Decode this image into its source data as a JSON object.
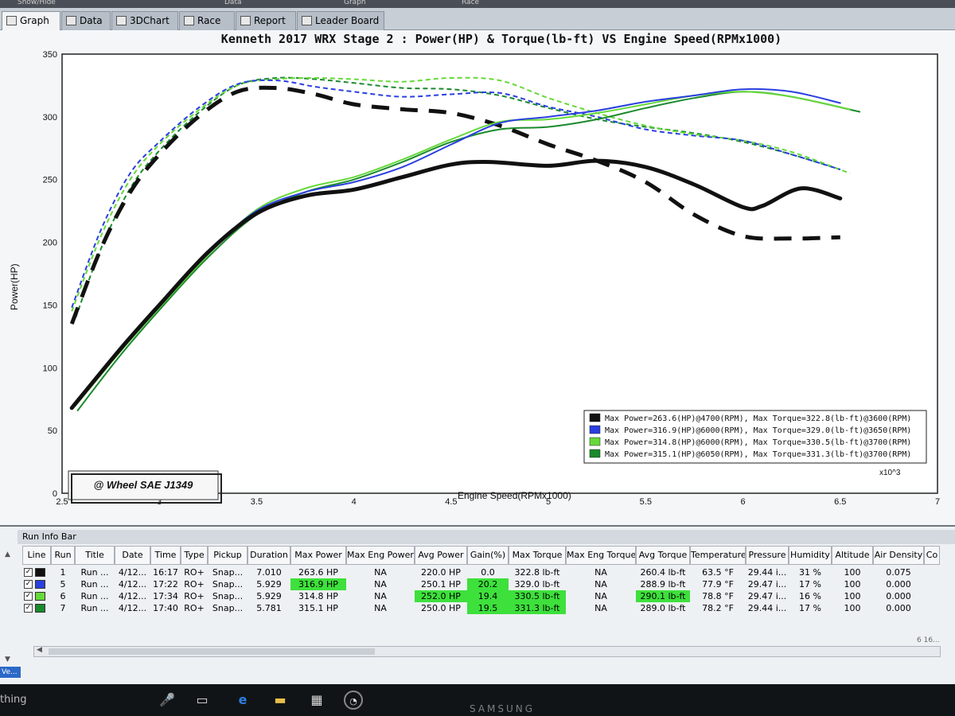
{
  "top_strip": {
    "items": [
      "Show/Hide",
      "Data",
      "Graph",
      "Race"
    ]
  },
  "tabs": [
    {
      "label": "Graph",
      "icon": "graph-icon",
      "active": true
    },
    {
      "label": "Data",
      "icon": "table-icon",
      "active": false
    },
    {
      "label": "3DChart",
      "icon": "chart3d-icon",
      "active": false
    },
    {
      "label": "Race",
      "icon": "checkered-flag-icon",
      "active": false
    },
    {
      "label": "Report",
      "icon": "report-icon",
      "active": false
    },
    {
      "label": "Leader Board",
      "icon": "checkered-flag-icon",
      "active": false
    }
  ],
  "chart_data": {
    "type": "line",
    "title": "Kenneth 2017 WRX Stage 2 : Power(HP) & Torque(lb-ft) VS Engine Speed(RPMx1000)",
    "xlabel": "Engine Speed(RPMx1000)",
    "ylabel": "Power(HP)",
    "x_multiplier": "x10^3",
    "xlim": [
      2.5,
      7
    ],
    "ylim": [
      0,
      350
    ],
    "x_ticks": [
      "2.5",
      "3",
      "3.5",
      "4",
      "4.5",
      "5",
      "5.5",
      "6",
      "6.5",
      "7"
    ],
    "y_ticks": [
      "0",
      "50",
      "100",
      "150",
      "200",
      "250",
      "300",
      "350"
    ],
    "grid": true,
    "legend_position": "bottom-right",
    "annotation": "@ Wheel SAE J1349",
    "legend": [
      "Max Power=263.6(HP)@4700(RPM), Max Torque=322.8(lb-ft)@3600(RPM)",
      "Max Power=316.9(HP)@6000(RPM), Max Torque=329.0(lb-ft)@3650(RPM)",
      "Max Power=314.8(HP)@6000(RPM), Max Torque=330.5(lb-ft)@3700(RPM)",
      "Max Power=315.1(HP)@6050(RPM), Max Torque=331.3(lb-ft)@3700(RPM)"
    ],
    "series": [
      {
        "run": "1",
        "color": "#111111",
        "width": 5,
        "power": [
          [
            2.55,
            68
          ],
          [
            2.8,
            115
          ],
          [
            3.0,
            150
          ],
          [
            3.25,
            192
          ],
          [
            3.5,
            223
          ],
          [
            3.75,
            237
          ],
          [
            4.0,
            242
          ],
          [
            4.25,
            252
          ],
          [
            4.5,
            262
          ],
          [
            4.7,
            264
          ],
          [
            5.0,
            261
          ],
          [
            5.25,
            265
          ],
          [
            5.5,
            260
          ],
          [
            5.75,
            246
          ],
          [
            6.0,
            228
          ],
          [
            6.1,
            229
          ],
          [
            6.3,
            243
          ],
          [
            6.5,
            235
          ]
        ],
        "torque": [
          [
            2.55,
            135
          ],
          [
            2.7,
            195
          ],
          [
            2.85,
            240
          ],
          [
            3.0,
            270
          ],
          [
            3.2,
            300
          ],
          [
            3.4,
            320
          ],
          [
            3.6,
            323
          ],
          [
            3.8,
            318
          ],
          [
            4.0,
            310
          ],
          [
            4.25,
            306
          ],
          [
            4.5,
            303
          ],
          [
            4.75,
            293
          ],
          [
            5.0,
            278
          ],
          [
            5.25,
            265
          ],
          [
            5.5,
            248
          ],
          [
            5.75,
            222
          ],
          [
            6.0,
            205
          ],
          [
            6.25,
            203
          ],
          [
            6.5,
            204
          ]
        ]
      },
      {
        "run": "5",
        "color": "#2a3fe0",
        "width": 2,
        "power": [
          [
            2.57,
            72
          ],
          [
            2.8,
            115
          ],
          [
            3.0,
            150
          ],
          [
            3.25,
            192
          ],
          [
            3.5,
            225
          ],
          [
            3.75,
            240
          ],
          [
            4.0,
            248
          ],
          [
            4.25,
            260
          ],
          [
            4.5,
            278
          ],
          [
            4.75,
            295
          ],
          [
            5.0,
            300
          ],
          [
            5.25,
            305
          ],
          [
            5.5,
            312
          ],
          [
            5.75,
            317
          ],
          [
            6.0,
            322
          ],
          [
            6.25,
            320
          ],
          [
            6.5,
            311
          ]
        ],
        "torque": [
          [
            2.55,
            148
          ],
          [
            2.7,
            210
          ],
          [
            2.85,
            255
          ],
          [
            3.0,
            280
          ],
          [
            3.2,
            307
          ],
          [
            3.4,
            326
          ],
          [
            3.6,
            329
          ],
          [
            3.8,
            324
          ],
          [
            4.0,
            320
          ],
          [
            4.25,
            316
          ],
          [
            4.5,
            318
          ],
          [
            4.75,
            319
          ],
          [
            5.0,
            308
          ],
          [
            5.25,
            300
          ],
          [
            5.5,
            290
          ],
          [
            5.75,
            285
          ],
          [
            6.0,
            281
          ],
          [
            6.25,
            270
          ],
          [
            6.5,
            258
          ]
        ]
      },
      {
        "run": "6",
        "color": "#66d93a",
        "width": 2,
        "power": [
          [
            2.57,
            70
          ],
          [
            2.8,
            113
          ],
          [
            3.0,
            148
          ],
          [
            3.25,
            190
          ],
          [
            3.5,
            226
          ],
          [
            3.75,
            243
          ],
          [
            4.0,
            252
          ],
          [
            4.25,
            266
          ],
          [
            4.5,
            282
          ],
          [
            4.75,
            296
          ],
          [
            5.0,
            298
          ],
          [
            5.25,
            303
          ],
          [
            5.5,
            310
          ],
          [
            5.75,
            317
          ],
          [
            6.0,
            320
          ],
          [
            6.25,
            316
          ],
          [
            6.55,
            306
          ]
        ],
        "torque": [
          [
            2.55,
            145
          ],
          [
            2.7,
            205
          ],
          [
            2.85,
            250
          ],
          [
            3.0,
            278
          ],
          [
            3.2,
            305
          ],
          [
            3.4,
            325
          ],
          [
            3.6,
            330
          ],
          [
            3.8,
            331
          ],
          [
            4.0,
            330
          ],
          [
            4.25,
            328
          ],
          [
            4.5,
            331
          ],
          [
            4.75,
            329
          ],
          [
            5.0,
            315
          ],
          [
            5.25,
            303
          ],
          [
            5.5,
            293
          ],
          [
            5.75,
            286
          ],
          [
            6.0,
            281
          ],
          [
            6.25,
            272
          ],
          [
            6.55,
            255
          ]
        ]
      },
      {
        "run": "7",
        "color": "#1b8a2c",
        "width": 2,
        "power": [
          [
            2.58,
            66
          ],
          [
            2.8,
            110
          ],
          [
            3.0,
            146
          ],
          [
            3.25,
            188
          ],
          [
            3.5,
            222
          ],
          [
            3.75,
            240
          ],
          [
            4.0,
            250
          ],
          [
            4.25,
            264
          ],
          [
            4.5,
            280
          ],
          [
            4.75,
            290
          ],
          [
            5.0,
            292
          ],
          [
            5.25,
            298
          ],
          [
            5.5,
            307
          ],
          [
            5.75,
            315
          ],
          [
            6.0,
            320
          ],
          [
            6.25,
            316
          ],
          [
            6.6,
            304
          ]
        ],
        "torque": [
          [
            2.57,
            140
          ],
          [
            2.7,
            195
          ],
          [
            2.85,
            243
          ],
          [
            3.0,
            273
          ],
          [
            3.2,
            303
          ],
          [
            3.4,
            325
          ],
          [
            3.6,
            331
          ],
          [
            3.8,
            330
          ],
          [
            4.0,
            327
          ],
          [
            4.25,
            323
          ],
          [
            4.5,
            322
          ],
          [
            4.75,
            317
          ],
          [
            5.0,
            307
          ],
          [
            5.25,
            298
          ],
          [
            5.5,
            292
          ],
          [
            5.75,
            287
          ],
          [
            6.0,
            280
          ],
          [
            6.25,
            270
          ],
          [
            6.5,
            258
          ]
        ]
      }
    ]
  },
  "run_info": {
    "title": "Run Info Bar",
    "columns": [
      "Line",
      "Run",
      "Title",
      "Date",
      "Time",
      "Type",
      "Pickup",
      "Duration",
      "Max Power",
      "Max Eng Power",
      "Avg Power",
      "Gain(%)",
      "Max Torque",
      "Max Eng Torque",
      "Avg Torque",
      "Temperature",
      "Pressure",
      "Humidity",
      "Altitude",
      "Air Density",
      "Co"
    ],
    "rows": [
      {
        "color": "#111111",
        "run": "1",
        "title": "Run ...",
        "date": "4/12...",
        "time": "16:17",
        "type": "RO+",
        "pickup": "Snap...",
        "duration": "7.010",
        "max_power": "263.6 HP",
        "max_eng_power": "NA",
        "avg_power": "220.0 HP",
        "gain": "0.0",
        "max_torque": "322.8 lb-ft",
        "max_eng_torque": "NA",
        "avg_torque": "260.4 lb-ft",
        "temperature": "63.5 °F",
        "pressure": "29.44 i...",
        "humidity": "31 %",
        "altitude": "100",
        "air_density": "0.075"
      },
      {
        "color": "#2a3fe0",
        "run": "5",
        "title": "Run ...",
        "date": "4/12...",
        "time": "17:22",
        "type": "RO+",
        "pickup": "Snap...",
        "duration": "5.929",
        "max_power": "316.9 HP",
        "max_eng_power": "NA",
        "avg_power": "250.1 HP",
        "gain": "20.2",
        "max_torque": "329.0 lb-ft",
        "max_eng_torque": "NA",
        "avg_torque": "288.9 lb-ft",
        "temperature": "77.9 °F",
        "pressure": "29.47 i...",
        "humidity": "17 %",
        "altitude": "100",
        "air_density": "0.000"
      },
      {
        "color": "#66d93a",
        "run": "6",
        "title": "Run ...",
        "date": "4/12...",
        "time": "17:34",
        "type": "RO+",
        "pickup": "Snap...",
        "duration": "5.929",
        "max_power": "314.8 HP",
        "max_eng_power": "NA",
        "avg_power": "252.0 HP",
        "gain": "19.4",
        "max_torque": "330.5 lb-ft",
        "max_eng_torque": "NA",
        "avg_torque": "290.1 lb-ft",
        "temperature": "78.8 °F",
        "pressure": "29.47 i...",
        "humidity": "16 %",
        "altitude": "100",
        "air_density": "0.000"
      },
      {
        "color": "#1b8a2c",
        "run": "7",
        "title": "Run ...",
        "date": "4/12...",
        "time": "17:40",
        "type": "RO+",
        "pickup": "Snap...",
        "duration": "5.781",
        "max_power": "315.1 HP",
        "max_eng_power": "NA",
        "avg_power": "250.0 HP",
        "gain": "19.5",
        "max_torque": "331.3 lb-ft",
        "max_eng_torque": "NA",
        "avg_torque": "289.0 lb-ft",
        "temperature": "78.2 °F",
        "pressure": "29.44 i...",
        "humidity": "17 %",
        "altitude": "100",
        "air_density": "0.000"
      }
    ],
    "highlight_color": "#3ee03c",
    "footer_text": "6 16..."
  },
  "taskbar": {
    "search_text": "thing",
    "icons": [
      "microphone-icon",
      "task-view-icon",
      "edge-icon",
      "file-explorer-icon",
      "store-icon",
      "dyno-gauge-icon"
    ],
    "monitor_brand": "SAMSUNG",
    "corner_label": "Ve..."
  }
}
